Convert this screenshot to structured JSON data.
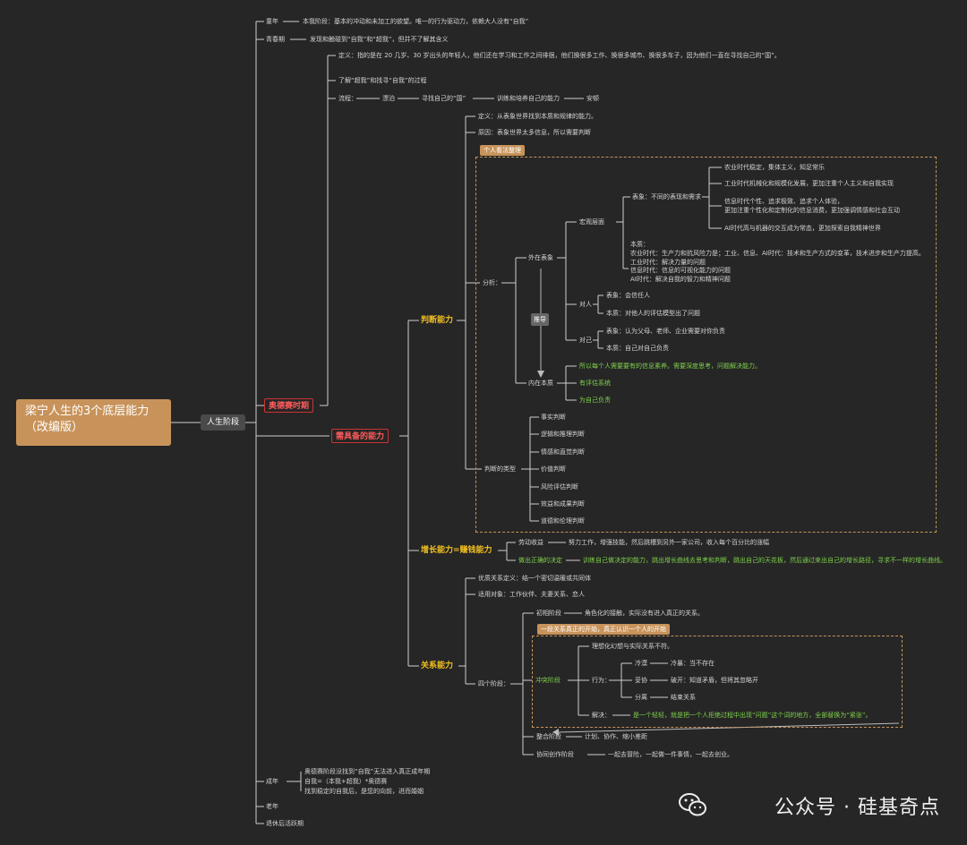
{
  "root": {
    "line1": "梁宁人生的3个底层能力",
    "line2": "（改编版）"
  },
  "stage": "人生阶段",
  "childhood": {
    "label": "童年",
    "desc": "本我阶段：基本的冲动和未加工的欲望。唯一的行为驱动力，依赖大人没有“自我”"
  },
  "puberty": {
    "label": "青春期",
    "desc": "发现和触碰到“自我”和“超我”，但并不了解其含义"
  },
  "odyssey": {
    "label": "奥德赛时期",
    "def": "定义：指的是在 20 几岁、30 岁出头的年轻人，他们还在学习和工作之间徘徊，他们换很多工作、换很多城市、换很多车子，因为他们一直在寻找自己的“国”。",
    "learn": "了解“超我”和找寻“自我”的过程",
    "flow": {
      "label": "流程：",
      "a": "漂泊",
      "b": "寻找自己的“国”",
      "c": "训练和培养自己的能力",
      "d": "安顿"
    }
  },
  "abilities": {
    "label": "需具备的能力"
  },
  "judge": {
    "label": "判断能力",
    "def": "定义：从表象世界找到本质和规律的能力。",
    "reason": "原因：表象世界太多信息，所以需要判断",
    "tag": "个人看法整理",
    "analysis": "分析：",
    "outer": "外在表象",
    "society": "宏观层面",
    "surface": "表象：不同的表现和需求",
    "items": [
      "农业时代稳定，集体主义，知足常乐",
      "工业时代机械化和规模化发展，更加注重个人主义和自我实现",
      "信息时代个性、追求极致、追求个人体验，",
      "更加注重个性化和定制化的信息消费，更加强调情感和社会互动",
      "AI时代高与机器的交互成为常态，更加探索自我精神世界"
    ],
    "essence": [
      "本质：",
      "农业时代：生产力和抗风险力是；工业、信息、AI时代：技术和生产方式的变革，技术进步和生产力提高。",
      "工业时代：解决力量的问题",
      "信息时代：信息的可视化能力的问题",
      "AI时代：解决自我的智力和精神问题"
    ],
    "infer": "推导",
    "others": {
      "label": "对人",
      "surface": "表象：会信任人",
      "essence": "本质：对他人的评估模型出了问题"
    },
    "self": {
      "label": "对己",
      "surface": "表象：认为父母、老师、企业需要对你负责",
      "essence": "本质：自己对自己负责"
    },
    "inner": "内在本质",
    "green": [
      "所以每个人需要要有的信息素养。需要深度思考，问题解决能力。",
      "有评估系统",
      "为自己负责"
    ],
    "types_label": "判断的类型",
    "types": [
      "事实判断",
      "逻辑和推理判断",
      "情感和直觉判断",
      "价值判断",
      "风险评估判断",
      "效益和成果判断",
      "道德和伦理判断"
    ]
  },
  "growth": {
    "label": "增长能力=赚钱能力",
    "labor": "劳动收益",
    "labor_desc": "努力工作，增强技能，然后跳槽到另外一家公司，收入每个百分比的涨幅",
    "decide": "做出正确的决定",
    "decide_desc": "训练自己做决定的能力，跳出增长曲线去思考和判断，跳出自己的天花板，然后通过来出自己的增长路径，寻求不一样的增长曲线。"
  },
  "relation": {
    "label": "关系能力",
    "def": "优质关系定义：结一个密切温暖或共同体",
    "targets": "适用对象：工作伙伴、夫妻关系、恋人",
    "four": "四个阶段：",
    "early": "初相阶段",
    "early_desc": "角色化的接触，实际没有进入真正的关系。",
    "tag": "一段关系真正的开始，真正认识一个人的开始",
    "conflict": "冲突阶段",
    "conflict_desc": "理想化幻想与实际关系不符。",
    "behavior": "行为：",
    "behaviors": [
      {
        "a": "冷漠",
        "b": "冷暴：当不存在"
      },
      {
        "a": "妥协",
        "b": "破开：知道矛盾，但将其忽略开"
      },
      {
        "a": "分离",
        "b": "结束关系"
      }
    ],
    "solve": "解决：",
    "solve_desc": "是一个轻轻，就是把一个人拒绝过程中出现“问题”这个词的地方，全部替换为“紧张”。",
    "integrate": "整合阶段",
    "integrate_desc": "计划、协作、缩小差距",
    "cocreate": "协同创作阶段",
    "cocreate_desc": "一起去冒险，一起做一件事情，一起去创业。"
  },
  "adult": {
    "label": "成年",
    "lines": [
      "奥德赛阶段没找到“自我”无法进入真正成年期",
      "自我=（本我+超我）*奥德赛",
      "找到稳定的自我后，是您的向前，进而婚姻"
    ]
  },
  "old": "老年",
  "retire": "退休后活跃期",
  "watermark": "公众号 · 硅基奇点"
}
